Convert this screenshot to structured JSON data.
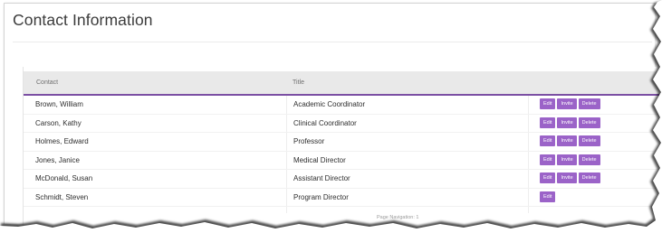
{
  "page": {
    "title": "Contact Information"
  },
  "table": {
    "columns": [
      "Contact",
      "Title"
    ],
    "rows": [
      {
        "contact": "Brown, William",
        "title": "Academic Coordinator",
        "actions": [
          "Edit",
          "Invite",
          "Delete"
        ]
      },
      {
        "contact": "Carson, Kathy",
        "title": "Clinical Coordinator",
        "actions": [
          "Edit",
          "Invite",
          "Delete"
        ]
      },
      {
        "contact": "Holmes, Edward",
        "title": "Professor",
        "actions": [
          "Edit",
          "Invite",
          "Delete"
        ]
      },
      {
        "contact": "Jones, Janice",
        "title": "Medical Director",
        "actions": [
          "Edit",
          "Invite",
          "Delete"
        ]
      },
      {
        "contact": "McDonald, Susan",
        "title": "Assistant Director",
        "actions": [
          "Edit",
          "Invite",
          "Delete"
        ]
      },
      {
        "contact": "Schmidt, Steven",
        "title": "Program Director",
        "actions": [
          "Edit"
        ]
      }
    ]
  },
  "pagination": {
    "text": "Page Navigation:  1"
  },
  "colors": {
    "accent": "#9b63c8",
    "header_rule": "#7b4fa3",
    "header_bg": "#e9e9e9"
  }
}
